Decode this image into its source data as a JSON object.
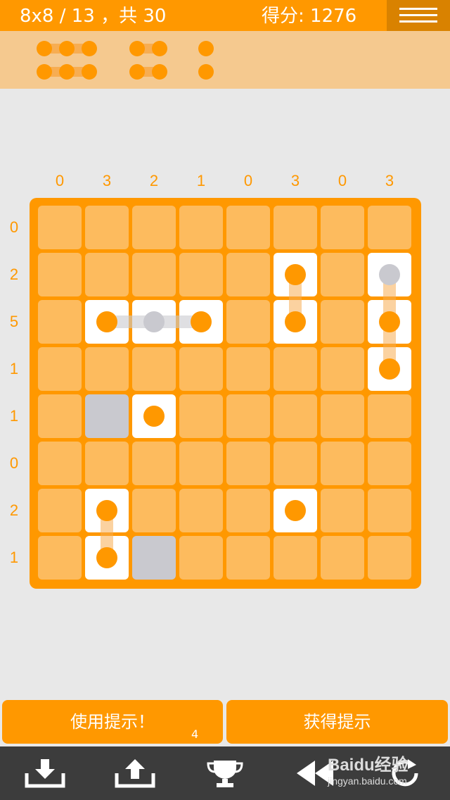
{
  "header": {
    "level": "8x8 / 13 ，共 30",
    "score": "得分: 1276"
  },
  "legend_pieces": [
    {
      "length": 3,
      "count": 2
    },
    {
      "length": 2,
      "count": 2
    },
    {
      "length": 1,
      "count": 2
    }
  ],
  "board": {
    "size": 8,
    "column_clues": [
      "0",
      "3",
      "2",
      "1",
      "0",
      "3",
      "0",
      "3"
    ],
    "row_clues": [
      "0",
      "2",
      "5",
      "1",
      "1",
      "0",
      "2",
      "1"
    ],
    "placed_cells": [
      {
        "r": 1,
        "c": 5,
        "dot": "orange"
      },
      {
        "r": 2,
        "c": 5,
        "dot": "orange"
      },
      {
        "r": 1,
        "c": 7,
        "dot": "gray"
      },
      {
        "r": 2,
        "c": 7,
        "dot": "orange"
      },
      {
        "r": 3,
        "c": 7,
        "dot": "orange"
      },
      {
        "r": 2,
        "c": 1,
        "dot": "orange"
      },
      {
        "r": 2,
        "c": 2,
        "dot": "gray"
      },
      {
        "r": 2,
        "c": 3,
        "dot": "orange"
      },
      {
        "r": 4,
        "c": 2,
        "dot": "orange"
      },
      {
        "r": 6,
        "c": 1,
        "dot": "orange"
      },
      {
        "r": 7,
        "c": 1,
        "dot": "orange"
      },
      {
        "r": 6,
        "c": 5,
        "dot": "orange"
      }
    ],
    "blocked_cells": [
      {
        "r": 4,
        "c": 1
      },
      {
        "r": 7,
        "c": 2
      }
    ],
    "links": [
      {
        "from": [
          1,
          5
        ],
        "to": [
          2,
          5
        ],
        "color": "orange"
      },
      {
        "from": [
          1,
          7
        ],
        "to": [
          3,
          7
        ],
        "color": "orange"
      },
      {
        "from": [
          2,
          1
        ],
        "to": [
          2,
          3
        ],
        "color": "gray"
      },
      {
        "from": [
          6,
          1
        ],
        "to": [
          7,
          1
        ],
        "color": "orange"
      }
    ]
  },
  "buttons": {
    "use_hint": "使用提示！",
    "hint_count": "4",
    "get_hint": "获得提示"
  },
  "toolbar": {
    "icons": [
      "download-icon",
      "upload-icon",
      "trophy-icon",
      "rewind-icon",
      "restart-icon"
    ]
  },
  "watermark": {
    "brand": "Baidu经验",
    "url": "jingyan.baidu.com"
  },
  "colors": {
    "accent": "#ff9800",
    "cell_empty": "#fdbb5e",
    "cell_placed": "#ffffff",
    "cell_blocked": "#c9c9cf",
    "legend_bg": "#f5c98f",
    "toolbar_bg": "#3c3c3c"
  }
}
